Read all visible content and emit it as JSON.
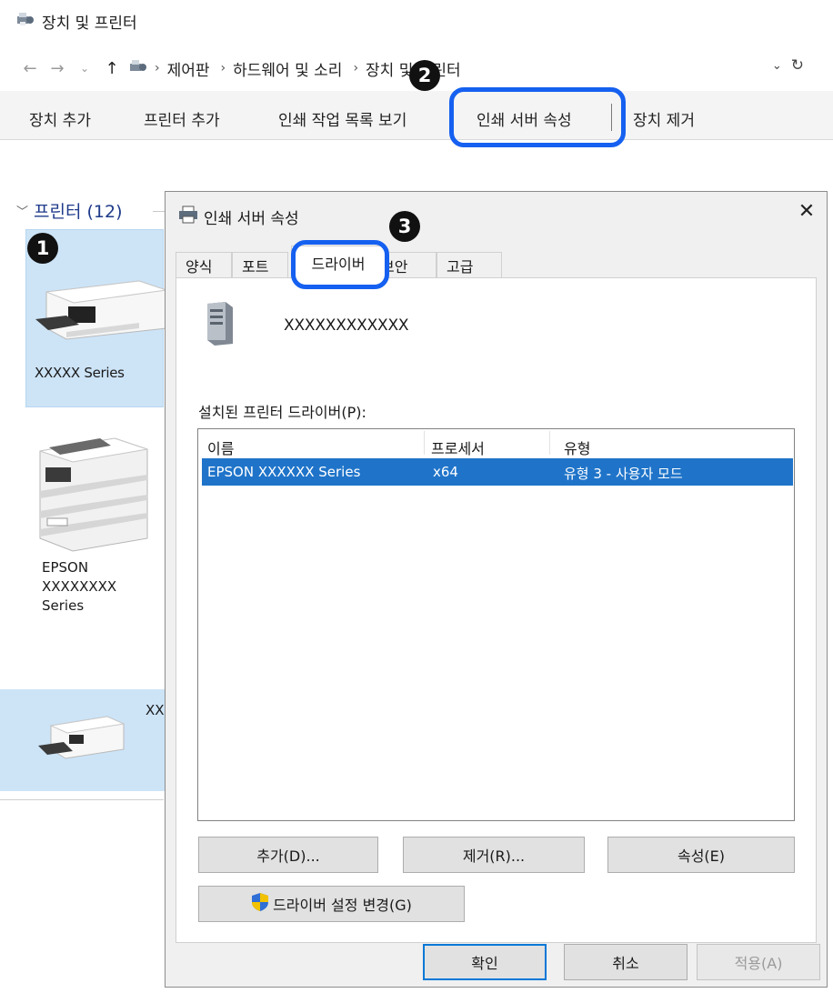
{
  "explorer": {
    "title": "장치 및 프린터",
    "address": {
      "crumbs": [
        "제어판",
        "하드웨어 및 소리",
        "장치 및 프린터"
      ]
    },
    "commands": [
      "장치 추가",
      "프린터 추가",
      "인쇄 작업 목록 보기",
      "인쇄 서버 속성",
      "장치 제거"
    ]
  },
  "devices": {
    "group_header": "프린터 (12)",
    "items": [
      {
        "label": "XXXXX Series",
        "selected": true
      },
      {
        "label_lines": [
          "EPSON",
          "XXXXXXXX",
          "Series"
        ]
      },
      {
        "label": "XX",
        "selected": true
      }
    ]
  },
  "dialog": {
    "title": "인쇄 서버 속성",
    "close_glyph": "✕",
    "tabs": [
      "양식",
      "포트",
      "드라이버",
      "보안",
      "고급"
    ],
    "active_tab": "드라이버",
    "server_name": "XXXXXXXXXXXX",
    "drivers_label": "설치된 프린터 드라이버(P):",
    "columns": [
      "이름",
      "프로세서",
      "유형"
    ],
    "rows": [
      {
        "name": "EPSON XXXXXX Series",
        "processor": "x64",
        "type": "유형 3 - 사용자 모드"
      }
    ],
    "buttons": {
      "add": "추가(D)...",
      "remove": "제거(R)...",
      "properties": "속성(E)",
      "change_settings": "드라이버 설정 변경(G)",
      "ok": "확인",
      "cancel": "취소",
      "apply": "적용(A)"
    }
  },
  "callouts": [
    "1",
    "2",
    "3"
  ],
  "colors": {
    "callout_ring": "#1560f0",
    "selection": "#1f74c9",
    "device_selected_bg": "#cde4f7"
  },
  "icons": [
    "devices-printers-icon",
    "back-arrow-icon",
    "forward-arrow-icon",
    "up-arrow-icon",
    "refresh-icon",
    "printer-icon",
    "server-icon",
    "shield-icon",
    "close-icon"
  ]
}
